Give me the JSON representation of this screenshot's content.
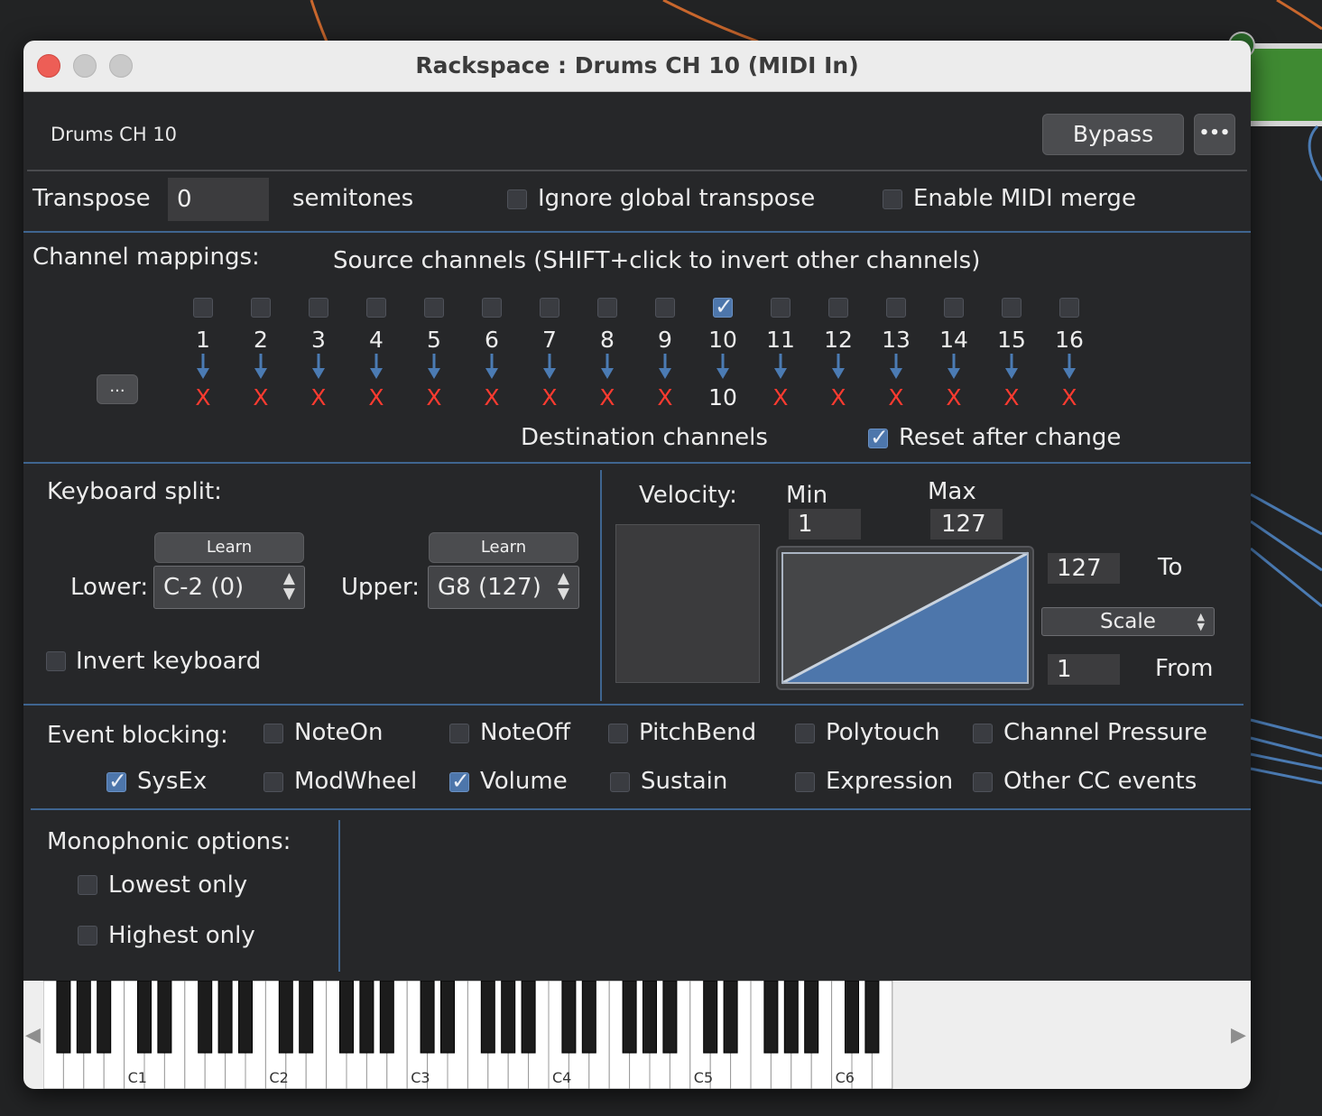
{
  "window": {
    "title": "Rackspace : Drums CH 10 (MIDI In)"
  },
  "header": {
    "plugin_name": "Drums CH 10",
    "bypass_label": "Bypass",
    "more_label": "•••"
  },
  "transpose": {
    "label": "Transpose",
    "value": "0",
    "unit": "semitones",
    "ignore_global_label": "Ignore global transpose",
    "ignore_global_checked": false,
    "midi_merge_label": "Enable MIDI merge",
    "midi_merge_checked": false
  },
  "channels": {
    "label": "Channel mappings:",
    "source_label": "Source channels (SHIFT+click to invert other channels)",
    "more_label": "...",
    "dest_label": "Destination channels",
    "reset_label": "Reset after change",
    "reset_checked": true,
    "items": [
      {
        "src": "1",
        "dest": "X",
        "checked": false
      },
      {
        "src": "2",
        "dest": "X",
        "checked": false
      },
      {
        "src": "3",
        "dest": "X",
        "checked": false
      },
      {
        "src": "4",
        "dest": "X",
        "checked": false
      },
      {
        "src": "5",
        "dest": "X",
        "checked": false
      },
      {
        "src": "6",
        "dest": "X",
        "checked": false
      },
      {
        "src": "7",
        "dest": "X",
        "checked": false
      },
      {
        "src": "8",
        "dest": "X",
        "checked": false
      },
      {
        "src": "9",
        "dest": "X",
        "checked": false
      },
      {
        "src": "10",
        "dest": "10",
        "checked": true
      },
      {
        "src": "11",
        "dest": "X",
        "checked": false
      },
      {
        "src": "12",
        "dest": "X",
        "checked": false
      },
      {
        "src": "13",
        "dest": "X",
        "checked": false
      },
      {
        "src": "14",
        "dest": "X",
        "checked": false
      },
      {
        "src": "15",
        "dest": "X",
        "checked": false
      },
      {
        "src": "16",
        "dest": "X",
        "checked": false
      }
    ]
  },
  "split": {
    "label": "Keyboard split:",
    "learn_label": "Learn",
    "lower_label": "Lower:",
    "lower_value": "C-2 (0)",
    "upper_label": "Upper:",
    "upper_value": "G8 (127)",
    "invert_label": "Invert keyboard",
    "invert_checked": false
  },
  "velocity": {
    "label": "Velocity:",
    "min_label": "Min",
    "min_value": "1",
    "max_label": "Max",
    "max_value": "127",
    "to_value": "127",
    "to_label": "To",
    "mode": "Scale",
    "from_value": "1",
    "from_label": "From"
  },
  "blocking": {
    "label": "Event blocking:",
    "items": [
      {
        "label": "NoteOn",
        "checked": false
      },
      {
        "label": "NoteOff",
        "checked": false
      },
      {
        "label": "PitchBend",
        "checked": false
      },
      {
        "label": "Polytouch",
        "checked": false
      },
      {
        "label": "Channel Pressure",
        "checked": false
      },
      {
        "label": "SysEx",
        "checked": true
      },
      {
        "label": "ModWheel",
        "checked": false
      },
      {
        "label": "Volume",
        "checked": true
      },
      {
        "label": "Sustain",
        "checked": false
      },
      {
        "label": "Expression",
        "checked": false
      },
      {
        "label": "Other CC events",
        "checked": false
      }
    ]
  },
  "mono": {
    "label": "Monophonic options:",
    "lowest_label": "Lowest only",
    "lowest_checked": false,
    "highest_label": "Highest only",
    "highest_checked": false
  },
  "keyboard": {
    "left_arrow": "◀",
    "right_arrow": "▶",
    "octave_labels": [
      "C1",
      "C2",
      "C3",
      "C4",
      "C5",
      "C6"
    ]
  },
  "colors": {
    "accent": "#4d76ab",
    "panel": "#262729",
    "separator": "#3f6590",
    "x_mark": "#ff3b30",
    "wire_orange": "#c9672d",
    "wire_blue": "#4b7bb3",
    "node_green": "#3f8a32"
  }
}
